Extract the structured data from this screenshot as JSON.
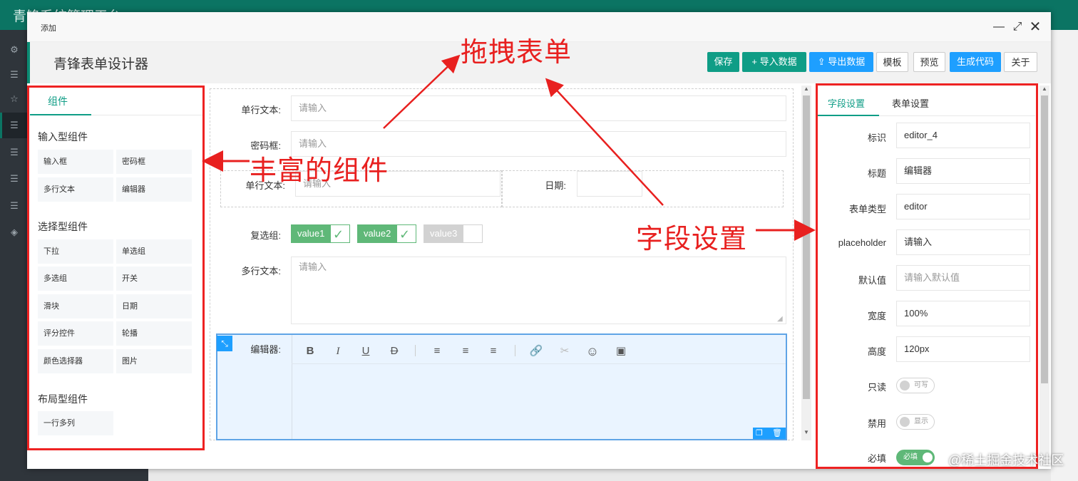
{
  "app": {
    "title": "青锋系统管理平台"
  },
  "modal": {
    "title": "添加",
    "icons": [
      "minimize-icon",
      "maximize-icon",
      "close-icon"
    ]
  },
  "designer": {
    "title": "青锋表单设计器",
    "buttons": {
      "save": "保存",
      "import": "导入数据",
      "export": "导出数据",
      "template": "模板",
      "preview": "预览",
      "generate": "生成代码",
      "about": "关于"
    }
  },
  "components": {
    "tab": "组件",
    "input_group": {
      "title": "输入型组件",
      "items": [
        "输入框",
        "密码框",
        "多行文本",
        "编辑器"
      ]
    },
    "select_group": {
      "title": "选择型组件",
      "items": [
        "下拉",
        "单选组",
        "多选组",
        "开关",
        "滑块",
        "日期",
        "评分控件",
        "轮播",
        "颜色选择器",
        "图片"
      ]
    },
    "layout_group": {
      "title": "布局型组件",
      "items": [
        "一行多列"
      ]
    }
  },
  "form": {
    "text1_label": "单行文本:",
    "text1_placeholder": "请输入",
    "pwd_label": "密码框:",
    "pwd_placeholder": "请输入",
    "row_text_label": "单行文本:",
    "row_text_placeholder": "请输入",
    "date_label": "日期:",
    "checkbox_label": "复选组:",
    "checkbox_values": [
      "value1",
      "value2",
      "value3"
    ],
    "textarea_label": "多行文本:",
    "textarea_placeholder": "请输入",
    "editor_label": "编辑器:"
  },
  "settings": {
    "tabs": [
      "字段设置",
      "表单设置"
    ],
    "fields": [
      {
        "label": "标识",
        "value": "editor_4"
      },
      {
        "label": "标题",
        "value": "编辑器"
      },
      {
        "label": "表单类型",
        "value": "editor"
      },
      {
        "label": "placeholder",
        "value": "请输入"
      },
      {
        "label": "默认值",
        "value": "请输入默认值"
      },
      {
        "label": "宽度",
        "value": "100%"
      },
      {
        "label": "高度",
        "value": "120px"
      }
    ],
    "readonly": {
      "label": "只读",
      "state": "可写"
    },
    "disabled": {
      "label": "禁用",
      "state": "显示"
    },
    "required": {
      "label": "必填",
      "state": "必填"
    }
  },
  "annotations": {
    "drag": "拖拽表单",
    "rich": "丰富的组件",
    "field": "字段设置"
  },
  "watermark": "@稀土掘金技术社区",
  "colors": {
    "primary": "#0f9d86",
    "blue": "#1e9fff",
    "annotation": "#e8201f",
    "header": "#0b7463"
  }
}
